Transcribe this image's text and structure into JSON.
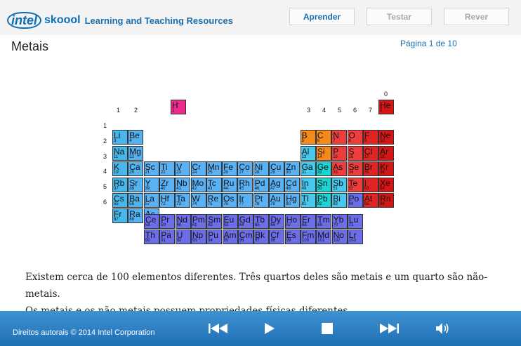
{
  "header": {
    "logo_intel": "intel",
    "logo_skoool": "skoool",
    "logo_tagline": "Learning and Teaching Resources",
    "buttons": [
      "Aprender",
      "Testar",
      "Rever"
    ]
  },
  "page": {
    "title": "Metais",
    "page_indicator": "Página 1 de 10"
  },
  "periodic_table": {
    "group_labels": [
      "1",
      "2",
      "3",
      "4",
      "5",
      "6",
      "7",
      "0"
    ],
    "period_labels": [
      "1",
      "2",
      "3",
      "4",
      "5",
      "6"
    ],
    "colors": {
      "alkali": "#47b6ea",
      "metal": "#54b2f0",
      "transition": "#5ab2f5",
      "poor_metal": "#46c8ef",
      "metalloid": "#1bd4d4",
      "nonmetal_orange": "#f58a1b",
      "nonmetal_red": "#ee3d3d",
      "halogen": "#e02424",
      "noble": "#d41616",
      "hydrogen": "#f02a8c",
      "lanthanide": "#6b6ee8",
      "actinide": "#6b6ee8"
    },
    "elements": [
      {
        "s": "H",
        "n": "1",
        "c": "hydrogen"
      },
      {
        "s": "He",
        "n": "2",
        "c": "noble"
      },
      {
        "s": "Li",
        "n": "3",
        "c": "alkali"
      },
      {
        "s": "Be",
        "n": "4",
        "c": "metal"
      },
      {
        "s": "B",
        "n": "5",
        "c": "nonmetal_orange"
      },
      {
        "s": "C",
        "n": "6",
        "c": "nonmetal_orange"
      },
      {
        "s": "N",
        "n": "7",
        "c": "nonmetal_red"
      },
      {
        "s": "O",
        "n": "8",
        "c": "nonmetal_red"
      },
      {
        "s": "F",
        "n": "9",
        "c": "halogen"
      },
      {
        "s": "Ne",
        "n": "10",
        "c": "noble"
      },
      {
        "s": "Na",
        "n": "11",
        "c": "alkali"
      },
      {
        "s": "Mg",
        "n": "12",
        "c": "metal"
      },
      {
        "s": "Al",
        "n": "13",
        "c": "poor_metal"
      },
      {
        "s": "Si",
        "n": "14",
        "c": "nonmetal_orange"
      },
      {
        "s": "P",
        "n": "15",
        "c": "nonmetal_red"
      },
      {
        "s": "S",
        "n": "16",
        "c": "nonmetal_red"
      },
      {
        "s": "Cl",
        "n": "17",
        "c": "halogen"
      },
      {
        "s": "Ar",
        "n": "18",
        "c": "noble"
      },
      {
        "s": "K",
        "n": "19",
        "c": "alkali"
      },
      {
        "s": "Ca",
        "n": "20",
        "c": "metal"
      },
      {
        "s": "Sc",
        "n": "21",
        "c": "transition"
      },
      {
        "s": "Ti",
        "n": "22",
        "c": "transition"
      },
      {
        "s": "V",
        "n": "23",
        "c": "transition"
      },
      {
        "s": "Cr",
        "n": "24",
        "c": "transition"
      },
      {
        "s": "Mn",
        "n": "25",
        "c": "transition"
      },
      {
        "s": "Fe",
        "n": "26",
        "c": "transition"
      },
      {
        "s": "Co",
        "n": "27",
        "c": "transition"
      },
      {
        "s": "Ni",
        "n": "28",
        "c": "transition"
      },
      {
        "s": "Cu",
        "n": "29",
        "c": "transition"
      },
      {
        "s": "Zn",
        "n": "30",
        "c": "transition"
      },
      {
        "s": "Ga",
        "n": "31",
        "c": "poor_metal"
      },
      {
        "s": "Ge",
        "n": "32",
        "c": "metalloid"
      },
      {
        "s": "As",
        "n": "33",
        "c": "nonmetal_red"
      },
      {
        "s": "Se",
        "n": "34",
        "c": "nonmetal_red"
      },
      {
        "s": "Br",
        "n": "35",
        "c": "halogen"
      },
      {
        "s": "Kr",
        "n": "36",
        "c": "noble"
      },
      {
        "s": "Rb",
        "n": "37",
        "c": "alkali"
      },
      {
        "s": "Sr",
        "n": "38",
        "c": "metal"
      },
      {
        "s": "Y",
        "n": "39",
        "c": "transition"
      },
      {
        "s": "Zr",
        "n": "40",
        "c": "transition"
      },
      {
        "s": "Nb",
        "n": "41",
        "c": "transition"
      },
      {
        "s": "Mo",
        "n": "42",
        "c": "transition"
      },
      {
        "s": "Tc",
        "n": "43",
        "c": "transition"
      },
      {
        "s": "Ru",
        "n": "44",
        "c": "transition"
      },
      {
        "s": "Rh",
        "n": "45",
        "c": "transition"
      },
      {
        "s": "Pd",
        "n": "46",
        "c": "transition"
      },
      {
        "s": "Ag",
        "n": "47",
        "c": "transition"
      },
      {
        "s": "Cd",
        "n": "48",
        "c": "transition"
      },
      {
        "s": "In",
        "n": "49",
        "c": "poor_metal"
      },
      {
        "s": "Sn",
        "n": "50",
        "c": "metalloid"
      },
      {
        "s": "Sb",
        "n": "51",
        "c": "poor_metal"
      },
      {
        "s": "Te",
        "n": "52",
        "c": "nonmetal_red"
      },
      {
        "s": "I",
        "n": "53",
        "c": "halogen"
      },
      {
        "s": "Xe",
        "n": "54",
        "c": "noble"
      },
      {
        "s": "Cs",
        "n": "55",
        "c": "alkali"
      },
      {
        "s": "Ba",
        "n": "56",
        "c": "metal"
      },
      {
        "s": "La",
        "n": "57",
        "c": "transition"
      },
      {
        "s": "Hf",
        "n": "72",
        "c": "transition"
      },
      {
        "s": "Ta",
        "n": "73",
        "c": "transition"
      },
      {
        "s": "W",
        "n": "74",
        "c": "transition"
      },
      {
        "s": "Re",
        "n": "75",
        "c": "transition"
      },
      {
        "s": "Os",
        "n": "76",
        "c": "transition"
      },
      {
        "s": "Ir",
        "n": "77",
        "c": "transition"
      },
      {
        "s": "Pt",
        "n": "78",
        "c": "transition"
      },
      {
        "s": "Au",
        "n": "79",
        "c": "transition"
      },
      {
        "s": "Hg",
        "n": "80",
        "c": "transition"
      },
      {
        "s": "Tl",
        "n": "81",
        "c": "poor_metal"
      },
      {
        "s": "Pb",
        "n": "82",
        "c": "metalloid"
      },
      {
        "s": "Bi",
        "n": "83",
        "c": "poor_metal"
      },
      {
        "s": "Po",
        "n": "84",
        "c": "lanthanide"
      },
      {
        "s": "At",
        "n": "85",
        "c": "halogen"
      },
      {
        "s": "Rn",
        "n": "86",
        "c": "noble"
      },
      {
        "s": "Fr",
        "n": "87",
        "c": "alkali"
      },
      {
        "s": "Ra",
        "n": "88",
        "c": "metal"
      },
      {
        "s": "Ac",
        "n": "89",
        "c": "transition"
      },
      {
        "s": "Ce",
        "n": "58",
        "c": "lanthanide"
      },
      {
        "s": "Pr",
        "n": "59",
        "c": "lanthanide"
      },
      {
        "s": "Nd",
        "n": "60",
        "c": "lanthanide"
      },
      {
        "s": "Pm",
        "n": "61",
        "c": "lanthanide"
      },
      {
        "s": "Sm",
        "n": "62",
        "c": "lanthanide"
      },
      {
        "s": "Eu",
        "n": "63",
        "c": "lanthanide"
      },
      {
        "s": "Gd",
        "n": "64",
        "c": "lanthanide"
      },
      {
        "s": "Tb",
        "n": "65",
        "c": "lanthanide"
      },
      {
        "s": "Dy",
        "n": "66",
        "c": "lanthanide"
      },
      {
        "s": "Ho",
        "n": "67",
        "c": "lanthanide"
      },
      {
        "s": "Er",
        "n": "68",
        "c": "lanthanide"
      },
      {
        "s": "Tm",
        "n": "69",
        "c": "lanthanide"
      },
      {
        "s": "Yb",
        "n": "70",
        "c": "lanthanide"
      },
      {
        "s": "Lu",
        "n": "71",
        "c": "lanthanide"
      },
      {
        "s": "Th",
        "n": "90",
        "c": "actinide"
      },
      {
        "s": "Pa",
        "n": "91",
        "c": "actinide"
      },
      {
        "s": "U",
        "n": "92",
        "c": "actinide"
      },
      {
        "s": "Np",
        "n": "93",
        "c": "actinide"
      },
      {
        "s": "Pu",
        "n": "94",
        "c": "actinide"
      },
      {
        "s": "Am",
        "n": "95",
        "c": "actinide"
      },
      {
        "s": "Cm",
        "n": "96",
        "c": "actinide"
      },
      {
        "s": "Bk",
        "n": "97",
        "c": "actinide"
      },
      {
        "s": "Cf",
        "n": "98",
        "c": "actinide"
      },
      {
        "s": "Es",
        "n": "99",
        "c": "actinide"
      },
      {
        "s": "Fm",
        "n": "100",
        "c": "actinide"
      },
      {
        "s": "Md",
        "n": "101",
        "c": "actinide"
      },
      {
        "s": "No",
        "n": "102",
        "c": "actinide"
      },
      {
        "s": "Lr",
        "n": "103",
        "c": "actinide"
      }
    ]
  },
  "description": {
    "line1": "Existem cerca de 100 elementos diferentes. Três quartos deles são metais e um quarto são não-metais.",
    "line2": "Os metais e os não-metais possuem propriedades físicas diferentes."
  },
  "footer": {
    "copyright": "Direitos autorais © 2014 Intel Corporation",
    "controls": [
      "rewind-icon",
      "play-icon",
      "stop-icon",
      "fast-forward-icon",
      "volume-icon"
    ]
  }
}
